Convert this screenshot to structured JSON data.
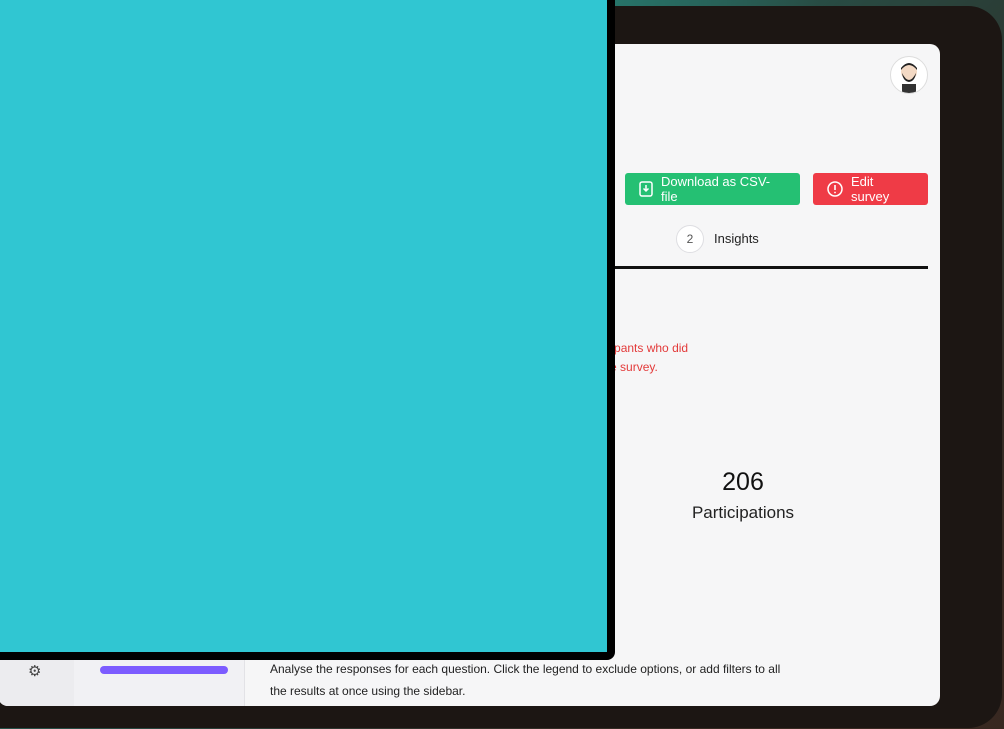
{
  "header": {
    "download_button": "Download as CSV-file",
    "edit_button": "Edit survey"
  },
  "tabs": [
    {
      "number": "2",
      "label": "Insights"
    }
  ],
  "warning": {
    "line1": "xclude participants who did",
    "line2": "his part of the survey."
  },
  "stats": {
    "participations_count": "206",
    "participations_label": "Participations"
  },
  "intro": {
    "text": "Analyse the responses for each question. Click the legend to exclude options, or add filters to all the results at once using the sidebar."
  },
  "colors": {
    "overlay": "#30c6d2",
    "csv_button": "#25c073",
    "edit_button": "#ef3b46",
    "warning_text": "#e33a3a"
  },
  "icons": {
    "download": "download-file-icon",
    "edit": "alert-circle-icon",
    "avatar": "user-avatar",
    "rail": "settings-gear-icon"
  }
}
